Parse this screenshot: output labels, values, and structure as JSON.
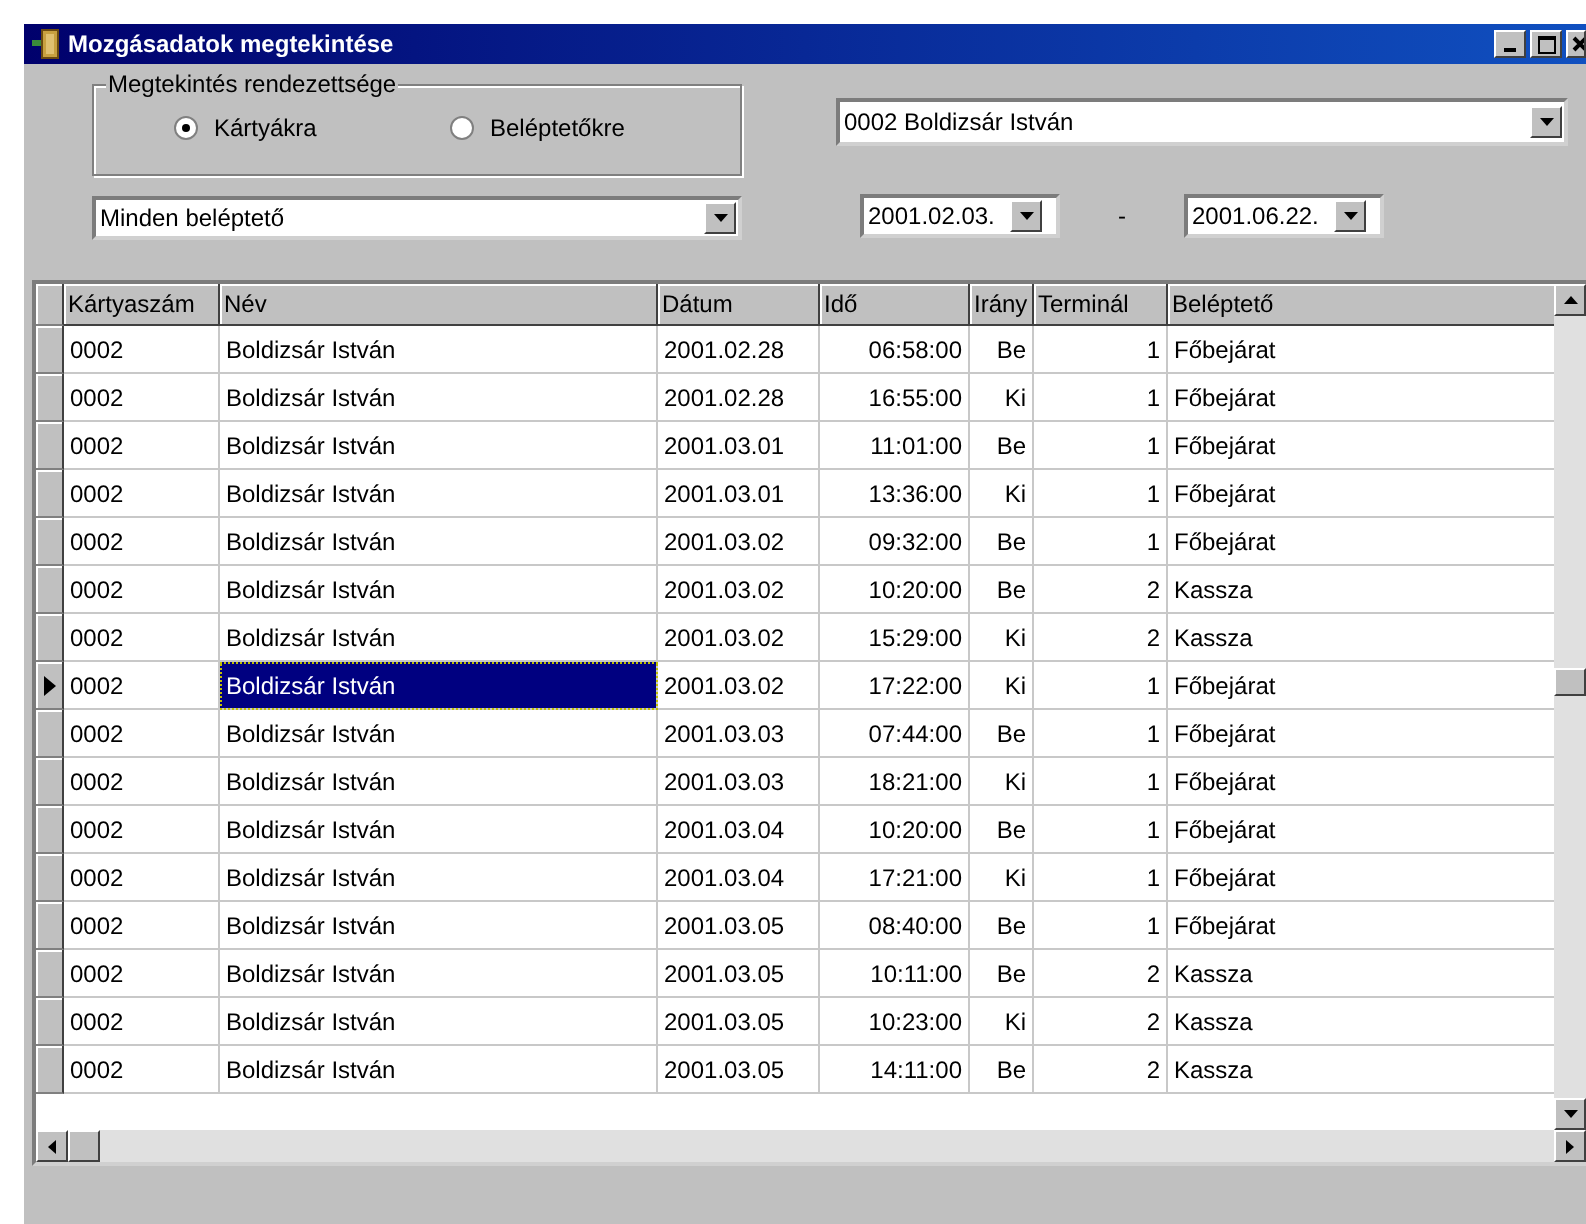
{
  "window": {
    "title": "Mozgásadatok megtekintése"
  },
  "sort_group": {
    "label": "Megtekintés rendezettsége",
    "options": [
      {
        "label": "Kártyákra",
        "selected": true
      },
      {
        "label": "Beléptetőkre",
        "selected": false
      }
    ]
  },
  "person_combo": {
    "value": "0002  Boldizsár István"
  },
  "gate_combo": {
    "value": "Minden beléptető"
  },
  "date_from": {
    "value": "2001.02.03."
  },
  "date_separator": "-",
  "date_to": {
    "value": "2001.06.22."
  },
  "table": {
    "columns": [
      "Kártyaszám",
      "Név",
      "Dátum",
      "Idő",
      "Irány",
      "Terminál",
      "Beléptető"
    ],
    "rows": [
      {
        "cells": [
          "0002",
          "Boldizsár István",
          "2001.02.28",
          "06:58:00",
          "Be",
          "1",
          "Főbejárat"
        ],
        "selected": false
      },
      {
        "cells": [
          "0002",
          "Boldizsár István",
          "2001.02.28",
          "16:55:00",
          "Ki",
          "1",
          "Főbejárat"
        ],
        "selected": false
      },
      {
        "cells": [
          "0002",
          "Boldizsár István",
          "2001.03.01",
          "11:01:00",
          "Be",
          "1",
          "Főbejárat"
        ],
        "selected": false
      },
      {
        "cells": [
          "0002",
          "Boldizsár István",
          "2001.03.01",
          "13:36:00",
          "Ki",
          "1",
          "Főbejárat"
        ],
        "selected": false
      },
      {
        "cells": [
          "0002",
          "Boldizsár István",
          "2001.03.02",
          "09:32:00",
          "Be",
          "1",
          "Főbejárat"
        ],
        "selected": false
      },
      {
        "cells": [
          "0002",
          "Boldizsár István",
          "2001.03.02",
          "10:20:00",
          "Be",
          "2",
          "Kassza"
        ],
        "selected": false
      },
      {
        "cells": [
          "0002",
          "Boldizsár István",
          "2001.03.02",
          "15:29:00",
          "Ki",
          "2",
          "Kassza"
        ],
        "selected": false
      },
      {
        "cells": [
          "0002",
          "Boldizsár István",
          "2001.03.02",
          "17:22:00",
          "Ki",
          "1",
          "Főbejárat"
        ],
        "selected": true
      },
      {
        "cells": [
          "0002",
          "Boldizsár István",
          "2001.03.03",
          "07:44:00",
          "Be",
          "1",
          "Főbejárat"
        ],
        "selected": false
      },
      {
        "cells": [
          "0002",
          "Boldizsár István",
          "2001.03.03",
          "18:21:00",
          "Ki",
          "1",
          "Főbejárat"
        ],
        "selected": false
      },
      {
        "cells": [
          "0002",
          "Boldizsár István",
          "2001.03.04",
          "10:20:00",
          "Be",
          "1",
          "Főbejárat"
        ],
        "selected": false
      },
      {
        "cells": [
          "0002",
          "Boldizsár István",
          "2001.03.04",
          "17:21:00",
          "Ki",
          "1",
          "Főbejárat"
        ],
        "selected": false
      },
      {
        "cells": [
          "0002",
          "Boldizsár István",
          "2001.03.05",
          "08:40:00",
          "Be",
          "1",
          "Főbejárat"
        ],
        "selected": false
      },
      {
        "cells": [
          "0002",
          "Boldizsár István",
          "2001.03.05",
          "10:11:00",
          "Be",
          "2",
          "Kassza"
        ],
        "selected": false
      },
      {
        "cells": [
          "0002",
          "Boldizsár István",
          "2001.03.05",
          "10:23:00",
          "Ki",
          "2",
          "Kassza"
        ],
        "selected": false
      },
      {
        "cells": [
          "0002",
          "Boldizsár István",
          "2001.03.05",
          "14:11:00",
          "Be",
          "2",
          "Kassza"
        ],
        "selected": false
      }
    ]
  }
}
